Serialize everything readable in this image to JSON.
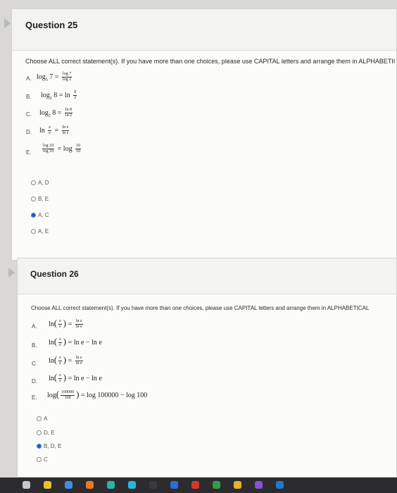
{
  "q25": {
    "title": "Question 25",
    "prompt": "Choose ALL correct statement(s). If you have more than one choices, please use CAPITAL letters and arrange them in ALPHABETICAL",
    "options": [
      {
        "letter": "A."
      },
      {
        "letter": "B."
      },
      {
        "letter": "C."
      },
      {
        "letter": "D."
      },
      {
        "letter": "E."
      }
    ],
    "choices": [
      "A, D",
      "B, E",
      "A, C",
      "A, E"
    ],
    "selected_index": 2
  },
  "q26": {
    "title": "Question 26",
    "prompt": "Choose ALL correct statement(s). If you have more than one choices, please use CAPITAL letters and arrange them in ALPHABETICAL",
    "options": [
      {
        "letter": "A."
      },
      {
        "letter": "B."
      },
      {
        "letter": "C."
      },
      {
        "letter": "D."
      },
      {
        "letter": "E."
      }
    ],
    "choices": [
      "A",
      "D, E",
      "B, D, E",
      "C"
    ],
    "selected_index": 2
  },
  "math": {
    "q25": {
      "a_lhs": "log",
      "a_base": "5",
      "a_arg": "7 =",
      "a_num": "log 7",
      "a_den": "log 2",
      "b_lhs": "log",
      "b_base": "2",
      "b_arg": "8 = ln",
      "b_num": "8",
      "b_den": "2",
      "c_lhs": "log",
      "c_base": "2",
      "c_arg": "8 =",
      "c_num": "ln 8",
      "c_den": "ln 2",
      "d_lhs": "ln",
      "d_num1": "e",
      "d_den1": "e",
      "d_mid": "=",
      "d_num2": "ln e",
      "d_den2": "ln e",
      "e_num1": "log 10",
      "e_den1": "log 10",
      "e_mid": "= log",
      "e_num2": "10",
      "e_den2": "10"
    },
    "q26": {
      "a_lhs": "ln",
      "a_num": "e",
      "a_den": "e",
      "a_mid": "=",
      "a_num2": "ln e",
      "a_den2": "ln e",
      "b_lhs": "ln",
      "b_num": "e",
      "b_den": "e",
      "b_rhs": "= ln e − ln e",
      "c_lhs": "ln",
      "c_num": "e",
      "c_den": "e",
      "c_mid": "=",
      "c_num2": "ln e",
      "c_den2": "ln e",
      "d_lhs": "ln",
      "d_num": "e",
      "d_den": "e",
      "d_rhs": "= ln e − ln e",
      "e_lhs": "log",
      "e_num": "100000",
      "e_den": "100",
      "e_rhs": "= log 100000 − log 100"
    }
  },
  "taskbar": {
    "icons": [
      {
        "name": "search-icon",
        "color": "#c8c8c8"
      },
      {
        "name": "chrome-icon",
        "color": "#e8c12c"
      },
      {
        "name": "app-icon-blue",
        "color": "#3c8ee6"
      },
      {
        "name": "app-icon-orange",
        "color": "#e97a2a"
      },
      {
        "name": "app-icon-teal",
        "color": "#2bb3a8"
      },
      {
        "name": "app-icon-cyan",
        "color": "#26b6e4"
      },
      {
        "name": "app-icon-dark",
        "color": "#3a3a3c"
      },
      {
        "name": "app-icon-blue2",
        "color": "#2a6fd1"
      },
      {
        "name": "app-icon-red",
        "color": "#d4372c"
      },
      {
        "name": "app-icon-green",
        "color": "#2ea044"
      },
      {
        "name": "app-icon-yellow",
        "color": "#e3b32c"
      },
      {
        "name": "app-icon-purple",
        "color": "#8a4fd6"
      },
      {
        "name": "app-icon-blue3",
        "color": "#1f77d1"
      }
    ]
  }
}
